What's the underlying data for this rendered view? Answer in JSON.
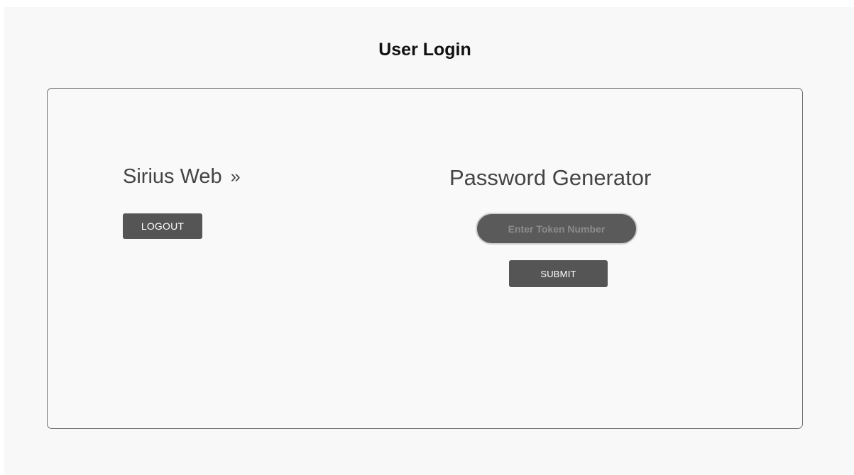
{
  "page": {
    "title": "User Login"
  },
  "left": {
    "brand": "Sirius Web",
    "brand_arrow": "»",
    "logout_label": "LOGOUT"
  },
  "right": {
    "title": "Password Generator",
    "token_input": {
      "value": "",
      "placeholder": "Enter Token Number"
    },
    "submit_label": "SUBMIT"
  },
  "colors": {
    "background": "#f8f8f8",
    "button": "#555555",
    "input": "#5a5a5a",
    "text": "#444444"
  }
}
